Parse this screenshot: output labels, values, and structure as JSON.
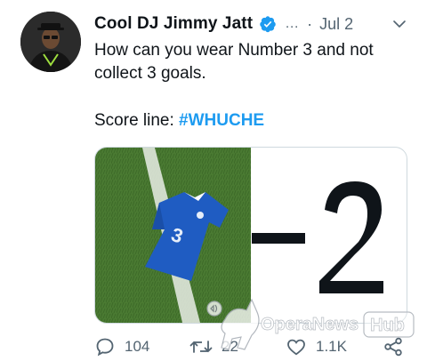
{
  "author": {
    "display_name": "Cool DJ Jimmy Jatt",
    "verified_icon": "verified-badge-icon"
  },
  "meta": {
    "more": "…",
    "separator": "·",
    "date": "Jul 2"
  },
  "tweet": {
    "line1": "How can you wear Number 3 and not collect 3 goals.",
    "score_prefix": "Score line: ",
    "hashtag": "#WHUCHE"
  },
  "media": {
    "score_text": "-2"
  },
  "actions": {
    "replies": "104",
    "retweets": "22",
    "likes": "1.1K"
  },
  "watermark": {
    "text": "OperaNews",
    "badge": "Hub"
  },
  "colors": {
    "link": "#1d9bf0",
    "muted": "#536471",
    "verified": "#1d9bf0",
    "jersey": "#1f5cc2",
    "grass": "#4a7a32"
  }
}
